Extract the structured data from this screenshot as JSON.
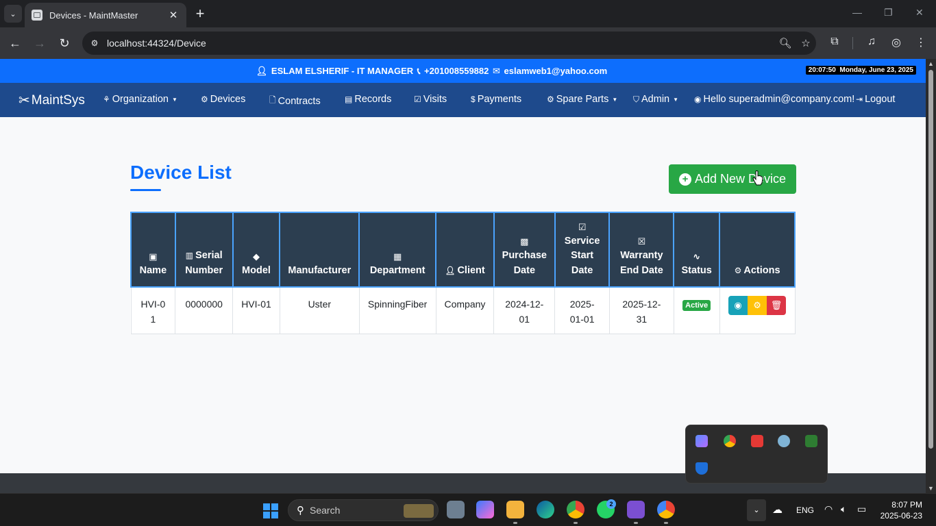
{
  "browser": {
    "tab_title": "Devices - MaintMaster",
    "tab_close": "✕",
    "new_tab": "+",
    "url": "localhost:44324/Device",
    "window_controls": [
      "—",
      "❐",
      "✕"
    ]
  },
  "topbar": {
    "user": "ESLAM ELSHERIF - IT MANAGER",
    "phone": "+201008559882",
    "email": "eslamweb1@yahoo.com",
    "time": "20:07:50",
    "date": "Monday, June 23, 2025"
  },
  "navbar": {
    "brand": "MaintSys",
    "items": [
      {
        "label": "Organization",
        "icon": "sitemap-icon",
        "dropdown": true
      },
      {
        "label": "Devices",
        "icon": "device-icon"
      },
      {
        "label": "Contracts",
        "icon": "file-icon"
      },
      {
        "label": "Records",
        "icon": "records-icon"
      },
      {
        "label": "Visits",
        "icon": "calendar-check-icon"
      },
      {
        "label": "Payments",
        "icon": "money-icon"
      },
      {
        "label": "Spare Parts",
        "icon": "gear-icon",
        "dropdown": true
      },
      {
        "label": "Admin",
        "icon": "shield-icon",
        "dropdown": true
      },
      {
        "label": "Hello superadmin@company.com!",
        "icon": "user-circle-icon"
      },
      {
        "label": "Logout",
        "icon": "logout-icon"
      }
    ]
  },
  "page": {
    "title": "Device List",
    "add_button": "Add New Device"
  },
  "table": {
    "headers": [
      {
        "line1": "Name",
        "line2": "",
        "line3": "",
        "icon": "tag-icon"
      },
      {
        "line1": "Serial",
        "line2": "Number",
        "line3": "",
        "icon": "barcode-icon"
      },
      {
        "line1": "Model",
        "line2": "",
        "line3": "",
        "icon": "tag-icon"
      },
      {
        "line1": "Manufacturer",
        "line2": "",
        "line3": "",
        "icon": ""
      },
      {
        "line1": "Department",
        "line2": "",
        "line3": "",
        "icon": "building-icon"
      },
      {
        "line1": "Client",
        "line2": "",
        "line3": "",
        "icon": "user-icon"
      },
      {
        "line1": "Purchase",
        "line2": "Date",
        "line3": "",
        "icon": "calendar-icon"
      },
      {
        "line1": "Service",
        "line2": "Start",
        "line3": "Date",
        "icon": "calendar-check-icon"
      },
      {
        "line1": "Warranty",
        "line2": "End Date",
        "line3": "",
        "icon": "calendar-x-icon"
      },
      {
        "line1": "Status",
        "line2": "",
        "line3": "",
        "icon": "pulse-icon"
      },
      {
        "line1": "Actions",
        "line2": "",
        "line3": "",
        "icon": "gear-icon"
      }
    ],
    "rows": [
      {
        "name": "HVI-01",
        "serial": "0000000",
        "model": "HVI-01",
        "manufacturer": "Uster",
        "department": "SpinningFiber",
        "client": "Company",
        "purchase_date": "2024-12-01",
        "service_start_date": "2025-01-01",
        "warranty_end_date": "2025-12-31",
        "status": "Active"
      }
    ]
  },
  "taskbar": {
    "search": "Search",
    "lang": "ENG",
    "time": "8:07 PM",
    "date": "2025-06-23",
    "whatsapp_badge": "2"
  },
  "colors": {
    "primary": "#0d6efd",
    "navbar": "#1e4a8c",
    "success": "#28a745",
    "info": "#17a2b8",
    "warning": "#ffc107",
    "danger": "#dc3545",
    "table_header": "#2c3e50"
  }
}
